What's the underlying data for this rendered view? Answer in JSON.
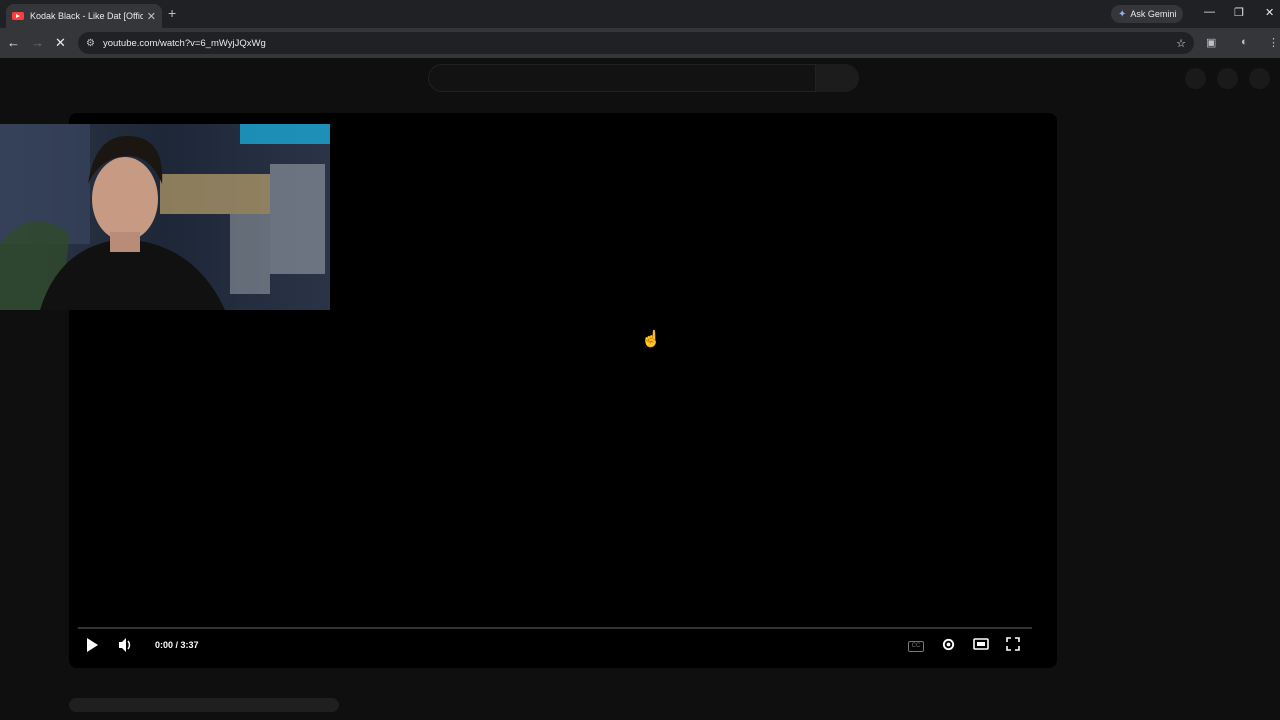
{
  "browser": {
    "tab_title": "Kodak Black - Like Dat [Official",
    "tab_close": "✕",
    "new_tab": "+",
    "ask_gemini": "Ask Gemini",
    "url": "youtube.com/watch?v=6_mWyjJQxWg",
    "window_controls": [
      "—",
      "❐",
      "✕"
    ]
  },
  "player": {
    "time_display": "0:00 / 3:37",
    "cc_label": "CC"
  },
  "colors": {
    "page_bg": "#0f0f0f",
    "tab_accent": "#ff3d3d",
    "gemini_accent": "#8ab4f8"
  },
  "icons": [
    "play-icon",
    "volume-icon",
    "settings-icon",
    "theater-icon",
    "fullscreen-icon",
    "star-icon",
    "back-arrow-icon",
    "forward-arrow-icon",
    "stop-icon",
    "site-info-icon"
  ]
}
